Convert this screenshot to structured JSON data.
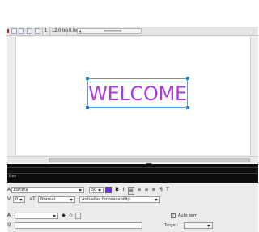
{
  "timeline": {
    "frame_number": "1",
    "frame_rate": "12.0 fps",
    "elapsed_time": "0.0s"
  },
  "stage": {
    "text_content": "WELCOME",
    "text_color": "#a93cd6",
    "selection_color": "#2f88d4"
  },
  "panel": {
    "title": "ties"
  },
  "properties": {
    "font_family": "Ebrima",
    "font_size": "50",
    "text_color": "#6b2fd8",
    "bold_icon": "B",
    "italic_icon": "I",
    "letter_spacing": "0",
    "position_mode": "Normal",
    "anti_alias": "Anti-alias for readability",
    "auto_kern_label": "Auto kern",
    "auto_kern_checked": true,
    "target_label": "Target:"
  }
}
